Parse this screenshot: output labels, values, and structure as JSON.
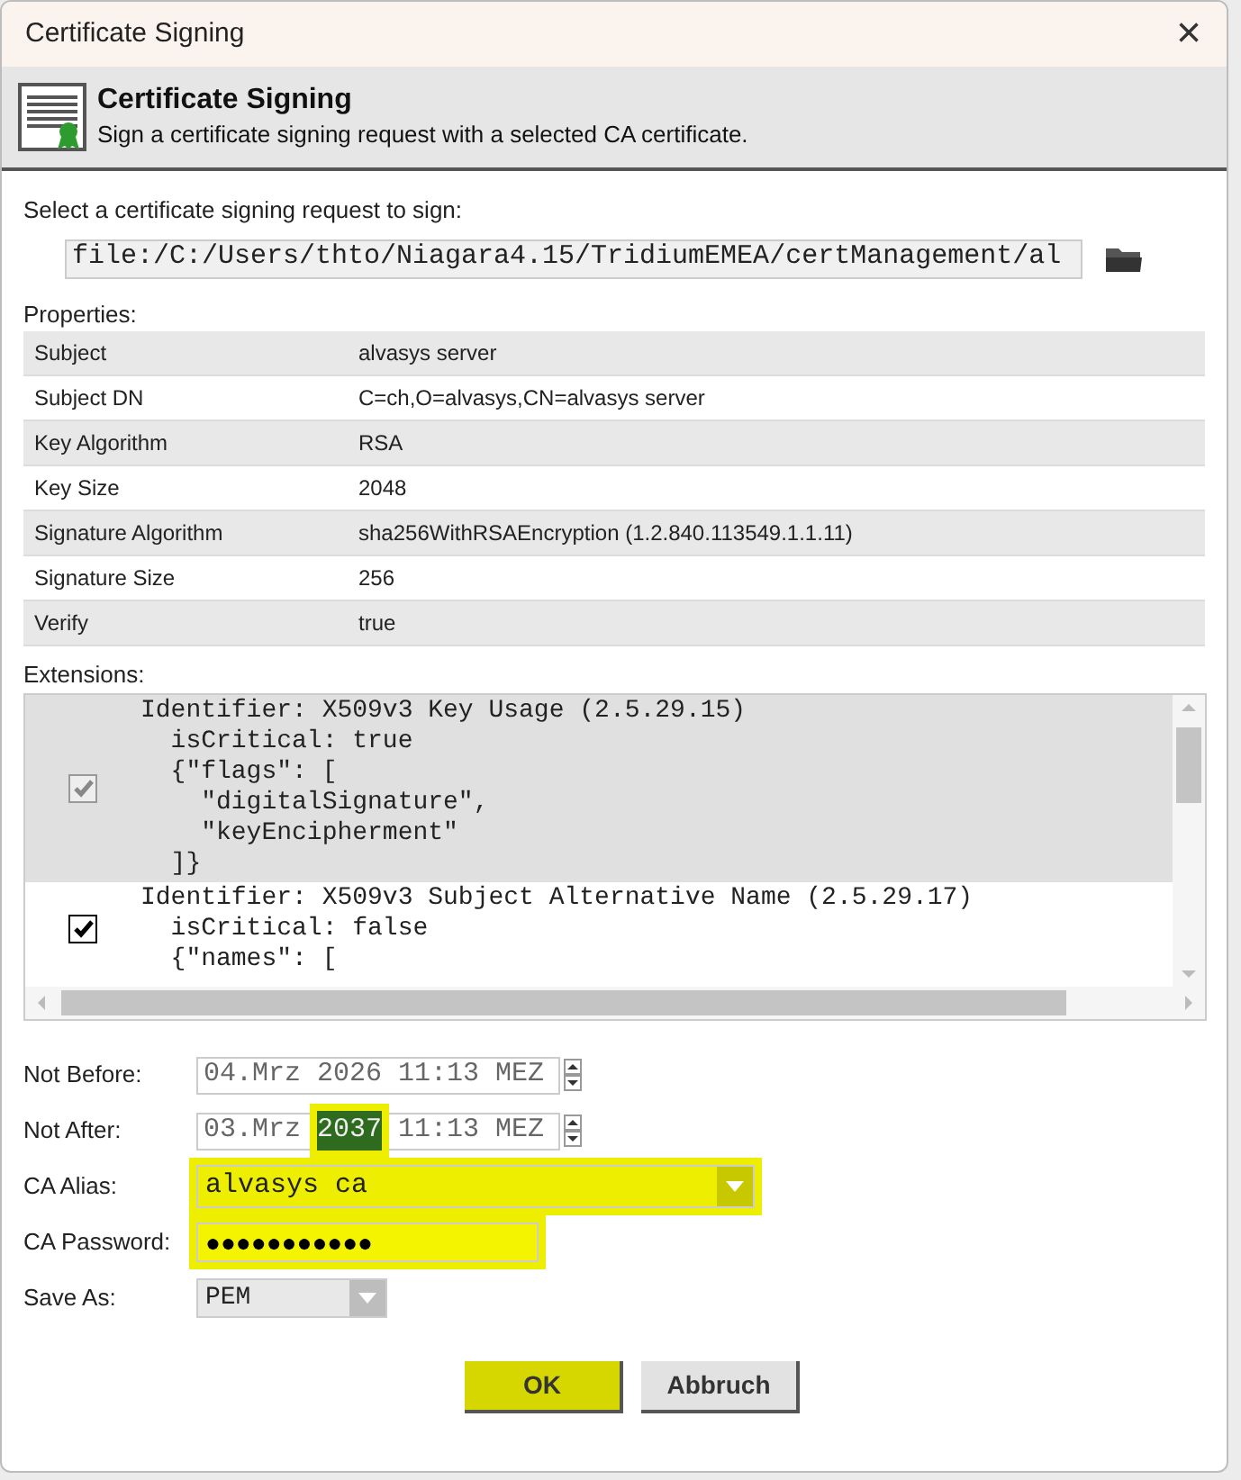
{
  "window": {
    "title": "Certificate Signing",
    "close": "×"
  },
  "header": {
    "title": "Certificate Signing",
    "subtitle": "Sign a certificate signing request with a selected CA certificate."
  },
  "csr": {
    "label": "Select a certificate signing request to sign:",
    "value": "file:/C:/Users/thto/Niagara4.15/TridiumEMEA/certManagement/al"
  },
  "properties": {
    "label": "Properties:",
    "rows": [
      {
        "name": "Subject",
        "value": "alvasys server"
      },
      {
        "name": "Subject DN",
        "value": "C=ch,O=alvasys,CN=alvasys server"
      },
      {
        "name": "Key Algorithm",
        "value": "RSA"
      },
      {
        "name": "Key Size",
        "value": "2048"
      },
      {
        "name": "Signature Algorithm",
        "value": "sha256WithRSAEncryption (1.2.840.113549.1.1.11)"
      },
      {
        "name": "Signature Size",
        "value": "256"
      },
      {
        "name": "Verify",
        "value": "true"
      }
    ]
  },
  "extensions": {
    "label": "Extensions:",
    "items": [
      {
        "checked": true,
        "selected": true,
        "lines": [
          "Identifier: X509v3 Key Usage (2.5.29.15)",
          "  isCritical: true",
          "  {\"flags\": [",
          "    \"digitalSignature\",",
          "    \"keyEncipherment\"",
          "  ]}"
        ]
      },
      {
        "checked": true,
        "selected": false,
        "lines": [
          "Identifier: X509v3 Subject Alternative Name (2.5.29.17)",
          "  isCritical: false",
          "  {\"names\": ["
        ]
      }
    ]
  },
  "fields": [
    {
      "kind": "date",
      "label": "Not Before:",
      "parts": [
        {
          "text": "04.Mrz 2026 11:13 MEZ",
          "selected": false,
          "highlighted": false
        }
      ]
    },
    {
      "kind": "date",
      "label": "Not After:",
      "parts": [
        {
          "text": "03.Mrz ",
          "selected": false,
          "highlighted": false
        },
        {
          "text": "2037",
          "selected": true,
          "highlighted": true
        },
        {
          "text": " 11:13 MEZ",
          "selected": false,
          "highlighted": false
        }
      ]
    },
    {
      "kind": "combo",
      "label": "CA Alias:",
      "value": "alvasys ca",
      "highlighted": true
    },
    {
      "kind": "password",
      "label": "CA Password:",
      "value": "●●●●●●●●●●●",
      "highlighted": true
    },
    {
      "kind": "smallcombo",
      "label": "Save As:",
      "value": "PEM",
      "highlighted": false
    }
  ],
  "buttons": [
    {
      "label": "OK",
      "highlighted": true
    },
    {
      "label": "Abbruch",
      "highlighted": false
    }
  ]
}
